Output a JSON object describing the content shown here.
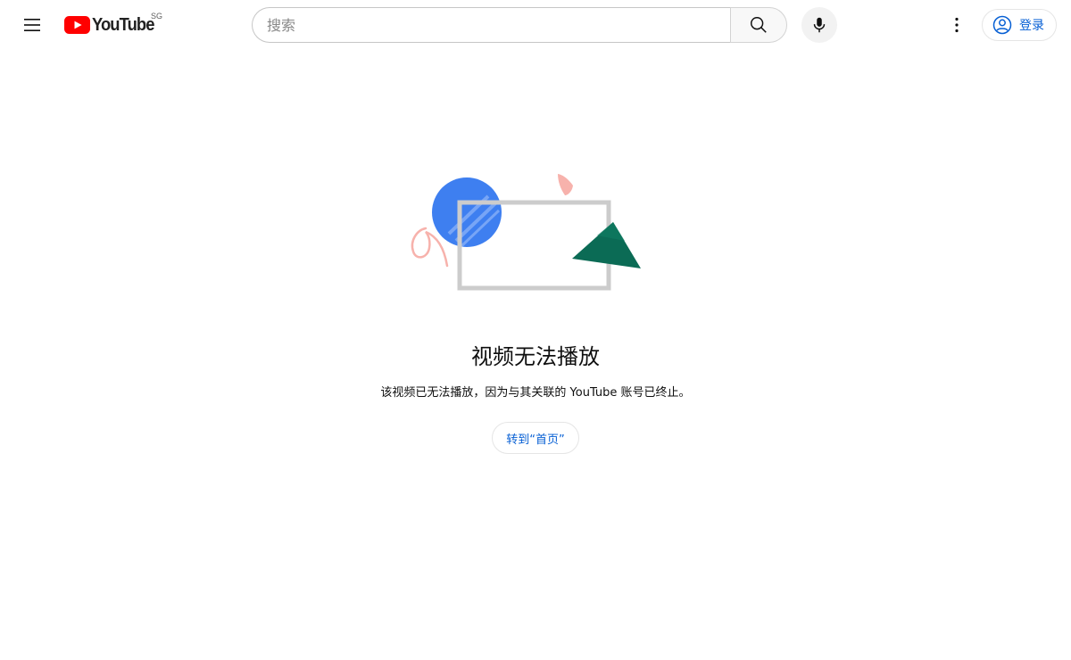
{
  "header": {
    "logo_text": "YouTube",
    "region_code": "SG",
    "search": {
      "placeholder": "搜索",
      "value": ""
    },
    "signin_label": "登录",
    "icons": [
      "menu-icon",
      "youtube-logo-icon",
      "search-icon",
      "mic-icon",
      "more-vert-icon",
      "account-circle-icon"
    ]
  },
  "error": {
    "title": "视频无法播放",
    "description": "该视频已无法播放，因为与其关联的 YouTube 账号已终止。",
    "home_button_label": "转到“首页”"
  },
  "colors": {
    "brand_red": "#ff0000",
    "link_blue": "#065fd4",
    "illustration_blue": "#3e7ff0",
    "illustration_green": "#0b6b55",
    "illustration_pink": "#f7b2ac",
    "illustration_frame": "#cccccc"
  }
}
